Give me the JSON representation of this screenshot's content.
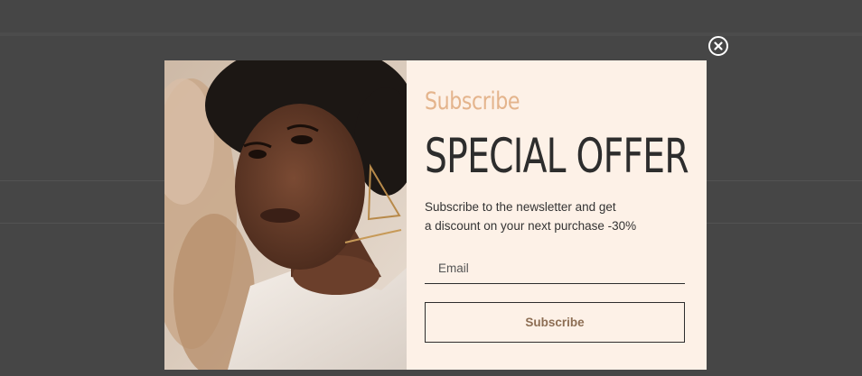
{
  "popup": {
    "kicker": "Subscribe",
    "headline": "SPECIAL OFFER",
    "description_line1": "Subscribe to the newsletter and get",
    "description_line2": "a discount on your next purchase -30%",
    "email_placeholder": "Email",
    "submit_label": "Subscribe",
    "close_icon": "close-circle-icon"
  },
  "colors": {
    "overlay": "#464646",
    "panel_bg": "#fdf1e7",
    "kicker": "#e4b48c",
    "headline": "#2d2d2d",
    "button_text": "#8d6e54"
  }
}
